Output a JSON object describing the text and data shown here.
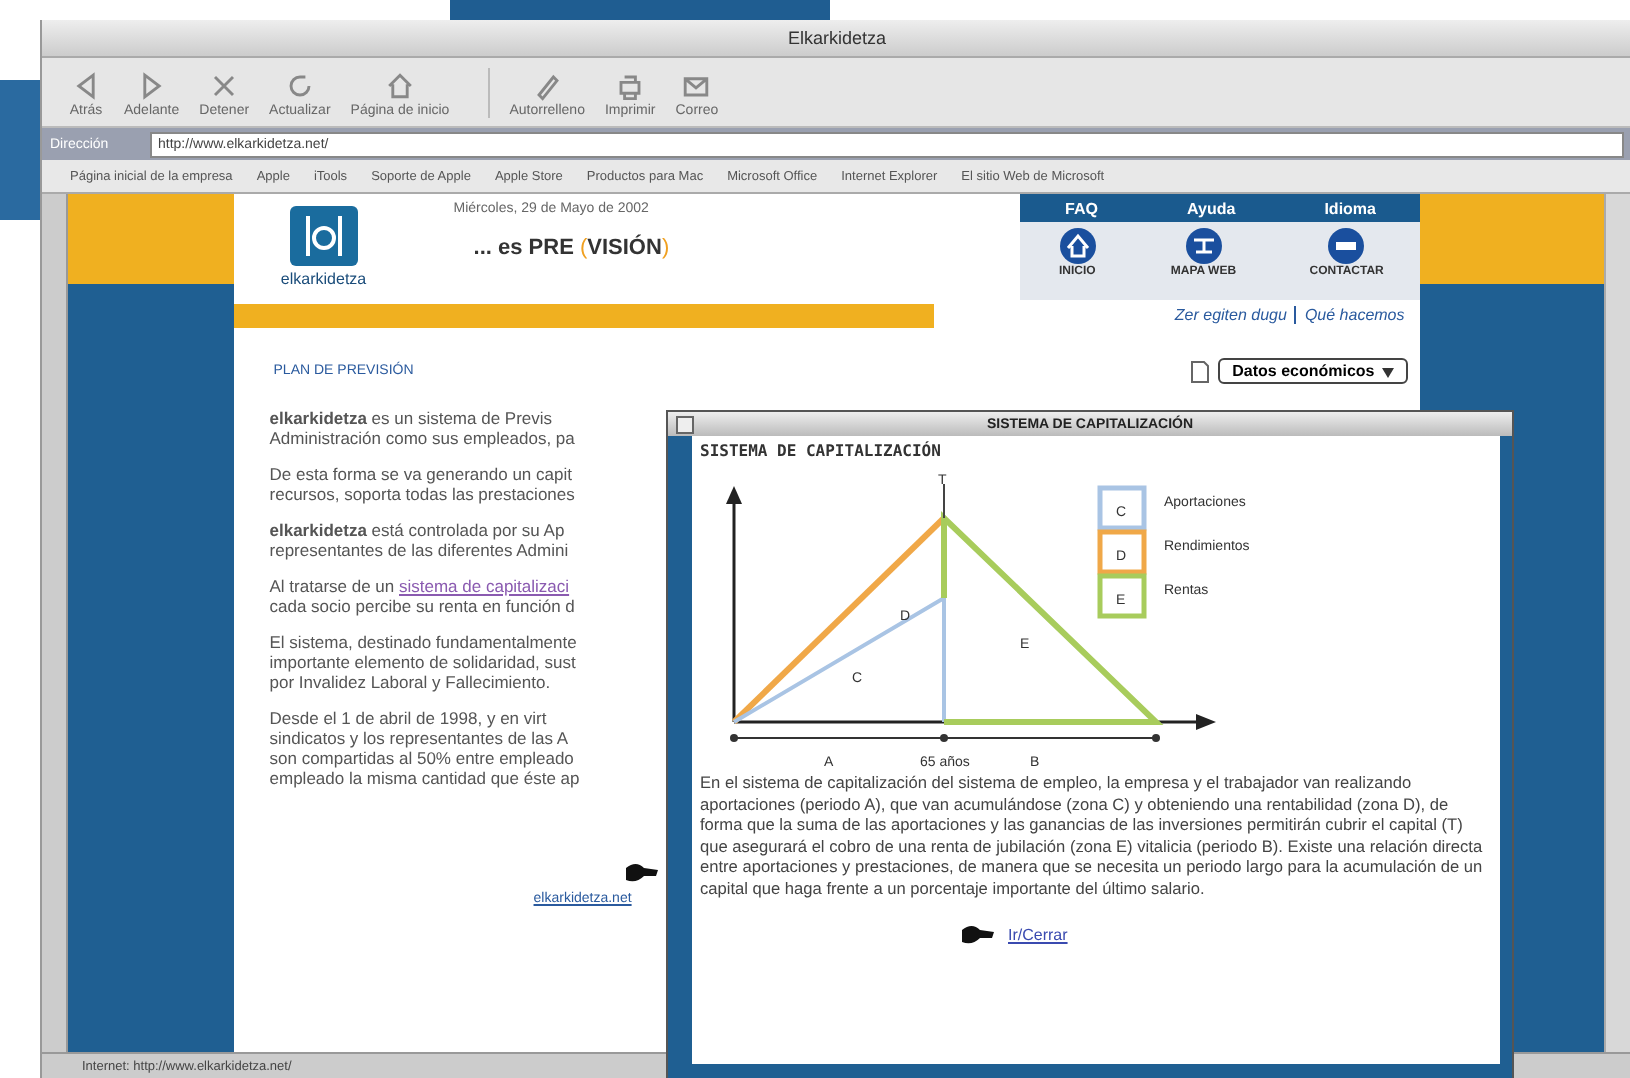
{
  "window": {
    "title": "Elkarkidetza"
  },
  "toolbar": [
    {
      "label": "Atrás"
    },
    {
      "label": "Adelante"
    },
    {
      "label": "Detener"
    },
    {
      "label": "Actualizar"
    },
    {
      "label": "Página de inicio"
    },
    {
      "label": "Autorrelleno"
    },
    {
      "label": "Imprimir"
    },
    {
      "label": "Correo"
    }
  ],
  "address_bar": {
    "label": "Dirección",
    "value": "http://www.elkarkidetza.net/"
  },
  "favorites": [
    "Página inicial de la empresa",
    "Apple",
    "iTools",
    "Soporte de Apple",
    "Apple Store",
    "Productos para Mac",
    "Microsoft Office",
    "Internet Explorer",
    "El sitio Web de Microsoft"
  ],
  "page": {
    "logo": "elkarkidetza",
    "date": "Miércoles, 29 de Mayo de 2002",
    "slogan": "... es PRE",
    "slogan_open": "(",
    "slogan_bracketed": "VISIÓN",
    "slogan_close": ")",
    "top_nav": [
      "FAQ",
      "Ayuda",
      "Idioma"
    ],
    "nav_icons": [
      {
        "label": "INICIO"
      },
      {
        "label": "MAPA WEB"
      },
      {
        "label": "CONTACTAR"
      }
    ],
    "section_links": [
      "Zer egiten dugu",
      "Qué hacemos"
    ],
    "section_title": "PLAN DE PREVISIÓN",
    "dropdown": {
      "value": "Datos económicos"
    },
    "paragraphs": [
      [
        "**elkarkidetza** es un sistema de Previs",
        "Administración como sus empleados, pa"
      ],
      [
        "De esta forma se va generando un capit",
        "recursos, soporta todas las prestaciones"
      ],
      [
        "**elkarkidetza** está controlada por su Ap",
        "representantes de las diferentes Admini"
      ],
      [
        {
          "before": "Al tratarse de un ",
          "link": "sistema de capitalizaci"
        },
        "cada socio percibe su renta en función d"
      ],
      [
        "El sistema, destinado fundamentalmente",
        "importante elemento de solidaridad, sust",
        "por Invalidez Laboral y Fallecimiento."
      ],
      [
        "Desde el 1 de abril de 1998, y en virt",
        "sindicatos y los representantes de las A",
        "son compartidas al 50% entre empleado",
        "empleado la misma cantidad que éste ap"
      ]
    ],
    "footer_link": "elkarkidetza.net"
  },
  "status_bar": "Internet: http://www.elkarkidetza.net/",
  "popup": {
    "title": "SISTEMA DE CAPITALIZACIÓN",
    "heading": "SISTEMA DE CAPITALIZACIÓN",
    "legend": [
      {
        "letter": "C",
        "label": "Aportaciones",
        "color": "#a9c4e4"
      },
      {
        "letter": "D",
        "label": "Rendimientos",
        "color": "#f0a848"
      },
      {
        "letter": "E",
        "label": "Rentas",
        "color": "#a8cc5c"
      }
    ],
    "diagram_labels": {
      "top": "T",
      "period_a": "A",
      "age": "65 años",
      "period_b": "B",
      "zone_c": "C",
      "zone_d": "D",
      "zone_e": "E"
    },
    "text": "En el sistema de capitalización del sistema de empleo, la empresa y el trabajador van realizando aportaciones (periodo A), que van acumulándose (zona C) y obteniendo una rentabilidad (zona D), de forma que la suma de las aportaciones y las ganancias de las inversiones permitirán cubrir el capital (T) que asegurará el cobro de una renta de jubilación (zona E) vitalicia (periodo B). Existe una relación directa entre aportaciones y prestaciones, de manera que se necesita un periodo largo para la acumulación de un capital que haga frente a un porcentaje importante del último salario.",
    "close_link": "Ir/Cerrar"
  }
}
